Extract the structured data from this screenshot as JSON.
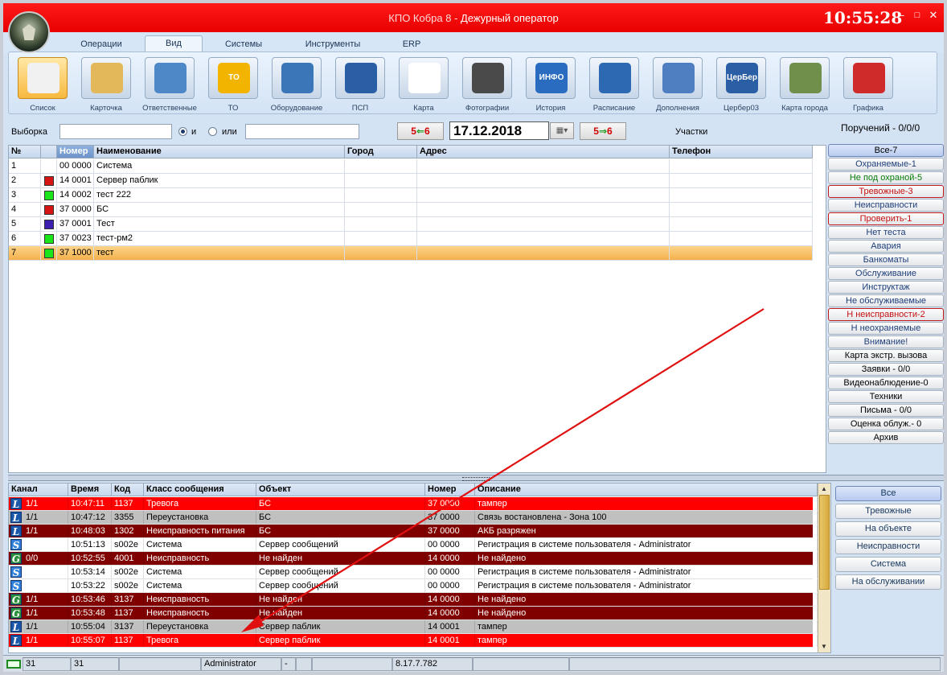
{
  "window": {
    "app_name": "КПО Кобра 8 - ",
    "role": "Дежурный оператор",
    "clock": "10:55:28"
  },
  "tabs": [
    {
      "label": "Операции"
    },
    {
      "label": "Вид"
    },
    {
      "label": "Системы"
    },
    {
      "label": "Инструменты"
    },
    {
      "label": "ERP"
    }
  ],
  "ribbon": [
    {
      "label": "Список",
      "icon": "list-icon",
      "glyph": ""
    },
    {
      "label": "Карточка",
      "icon": "folder-icon",
      "glyph": ""
    },
    {
      "label": "Ответственные",
      "icon": "people-icon",
      "glyph": ""
    },
    {
      "label": "ТО",
      "icon": "maintenance-icon",
      "glyph": "ТО"
    },
    {
      "label": "Оборудование",
      "icon": "equipment-icon",
      "glyph": ""
    },
    {
      "label": "ПСП",
      "icon": "signature-icon",
      "glyph": ""
    },
    {
      "label": "Карта",
      "icon": "floorplan-icon",
      "glyph": ""
    },
    {
      "label": "Фотографии",
      "icon": "camera-icon",
      "glyph": ""
    },
    {
      "label": "История",
      "icon": "history-info-icon",
      "glyph": "ИНФО"
    },
    {
      "label": "Расписание",
      "icon": "calendar-icon",
      "glyph": ""
    },
    {
      "label": "Дополнения",
      "icon": "documents-icon",
      "glyph": ""
    },
    {
      "label": "Цербер03",
      "icon": "cerber-icon",
      "glyph": "ЦерБер"
    },
    {
      "label": "Карта города",
      "icon": "city-map-icon",
      "glyph": ""
    },
    {
      "label": "Графика",
      "icon": "graphics-icon",
      "glyph": ""
    }
  ],
  "filter": {
    "selection_label": "Выборка",
    "and_label": "и",
    "or_label": "или",
    "swap_left": "5",
    "swap_right": "6",
    "date": "17.12.2018",
    "sections_label": "Участки",
    "orders": "Поручений - 0/0/0"
  },
  "objects": {
    "columns": [
      "№",
      "",
      "Номер",
      "Наименование",
      "Город",
      "Адрес",
      "Телефон"
    ],
    "rows": [
      {
        "n": "1",
        "num": "00  0000",
        "name": "Система",
        "color": ""
      },
      {
        "n": "2",
        "num": "14  0001",
        "name": "Сервер паблик",
        "color": "#d61414"
      },
      {
        "n": "3",
        "num": "14  0002",
        "name": "тест 222",
        "color": "#19e619"
      },
      {
        "n": "4",
        "num": "37  0000",
        "name": "БС",
        "color": "#d61414"
      },
      {
        "n": "5",
        "num": "37  0001",
        "name": "Тест",
        "color": "#3c1fb0"
      },
      {
        "n": "6",
        "num": "37  0023",
        "name": "тест-рм2",
        "color": "#19e619"
      },
      {
        "n": "7",
        "num": "37  1000",
        "name": "тест",
        "color": "#19e619"
      }
    ]
  },
  "object_filters": [
    {
      "label": "Все-7",
      "color": "#000000"
    },
    {
      "label": "Охраняемые-1",
      "color": "#1f3f7a"
    },
    {
      "label": "Не под охраной-5",
      "color": "#0a7d0a"
    },
    {
      "label": "Тревожные-3",
      "color": "#c41010"
    },
    {
      "label": "Неисправности",
      "color": "#1f3f7a"
    },
    {
      "label": "Проверить-1",
      "color": "#c41010"
    },
    {
      "label": "Нет теста",
      "color": "#1f3f7a"
    },
    {
      "label": "Авария",
      "color": "#1f3f7a"
    },
    {
      "label": "Банкоматы",
      "color": "#1f3f7a"
    },
    {
      "label": "Обслуживание",
      "color": "#1f3f7a"
    },
    {
      "label": "Инструктаж",
      "color": "#1f3f7a"
    },
    {
      "label": "Не обслуживаемые",
      "color": "#1f3f7a"
    },
    {
      "label": "Н неисправности-2",
      "color": "#c41010"
    },
    {
      "label": "Н неохраняемые",
      "color": "#1f3f7a"
    },
    {
      "label": "Внимание!",
      "color": "#1f3f7a"
    },
    {
      "label": "Карта экстр. вызова",
      "color": "#000000"
    },
    {
      "label": "Заявки - 0/0",
      "color": "#000000"
    },
    {
      "label": "Видеонаблюдение-0",
      "color": "#000000"
    },
    {
      "label": "Техники",
      "color": "#000000"
    },
    {
      "label": "Письма - 0/0",
      "color": "#000000"
    },
    {
      "label": "Оценка облуж.- 0",
      "color": "#000000"
    },
    {
      "label": "Архив",
      "color": "#000000"
    }
  ],
  "events": {
    "columns": [
      "Канал",
      "Время",
      "Код",
      "Класс сообщения",
      "Объект",
      "Номер",
      "Описание"
    ],
    "rows": [
      {
        "icon": "L",
        "ch": "1/1",
        "time": "10:47:11",
        "code": "1137",
        "cls": "Тревога",
        "obj": "БС",
        "num": "37 0000",
        "desc": "тампер",
        "bg": "#ff0000",
        "fg": "#ffffff"
      },
      {
        "icon": "L",
        "ch": "1/1",
        "time": "10:47:12",
        "code": "3355",
        "cls": "Переустановка",
        "obj": "БС",
        "num": "37 0000",
        "desc": "Связь востановлена - Зона 100",
        "bg": "#c0c0c0",
        "fg": "#000000"
      },
      {
        "icon": "L",
        "ch": "1/1",
        "time": "10:48:03",
        "code": "1302",
        "cls": "Неисправность питания",
        "obj": "БС",
        "num": "37 0000",
        "desc": "АКБ разряжен",
        "bg": "#800000",
        "fg": "#ffffff"
      },
      {
        "icon": "S",
        "ch": "",
        "time": "10:51:13",
        "code": "s002e",
        "cls": "Система",
        "obj": "Сервер сообщений",
        "num": "00 0000",
        "desc": "Регистрация в системе пользователя - Administrator",
        "bg": "#ffffff",
        "fg": "#000000"
      },
      {
        "icon": "G",
        "ch": "0/0",
        "time": "10:52:55",
        "code": "4001",
        "cls": "Неисправность",
        "obj": "Не найден",
        "num": "14 0000",
        "desc": "Не найдено",
        "bg": "#800000",
        "fg": "#ffffff"
      },
      {
        "icon": "S",
        "ch": "",
        "time": "10:53:14",
        "code": "s002e",
        "cls": "Система",
        "obj": "Сервер сообщений",
        "num": "00 0000",
        "desc": "Регистрация в системе пользователя - Administrator",
        "bg": "#ffffff",
        "fg": "#000000"
      },
      {
        "icon": "S",
        "ch": "",
        "time": "10:53:22",
        "code": "s002e",
        "cls": "Система",
        "obj": "Сервер сообщений",
        "num": "00 0000",
        "desc": "Регистрация в системе пользователя - Administrator",
        "bg": "#ffffff",
        "fg": "#000000"
      },
      {
        "icon": "G",
        "ch": "1/1",
        "time": "10:53:46",
        "code": "3137",
        "cls": "Неисправность",
        "obj": "Не найден",
        "num": "14 0000",
        "desc": "Не найдено",
        "bg": "#800000",
        "fg": "#ffffff"
      },
      {
        "icon": "G",
        "ch": "1/1",
        "time": "10:53:48",
        "code": "1137",
        "cls": "Неисправность",
        "obj": "Не найден",
        "num": "14 0000",
        "desc": "Не найдено",
        "bg": "#800000",
        "fg": "#ffffff"
      },
      {
        "icon": "L",
        "ch": "1/1",
        "time": "10:55:04",
        "code": "3137",
        "cls": "Переустановка",
        "obj": "Сервер паблик",
        "num": "14 0001",
        "desc": "тампер",
        "bg": "#c0c0c0",
        "fg": "#000000"
      },
      {
        "icon": "L",
        "ch": "1/1",
        "time": "10:55:07",
        "code": "1137",
        "cls": "Тревога",
        "obj": "Сервер паблик",
        "num": "14 0001",
        "desc": "тампер",
        "bg": "#ff0000",
        "fg": "#ffffff"
      }
    ]
  },
  "event_filters": [
    {
      "label": "Все"
    },
    {
      "label": "Тревожные"
    },
    {
      "label": "На объекте"
    },
    {
      "label": "Неисправности"
    },
    {
      "label": "Система"
    },
    {
      "label": "На обслуживании"
    }
  ],
  "status": {
    "count1": "31",
    "count2": "31",
    "user": "Administrator",
    "dash": "-",
    "version": "8.17.7.782"
  },
  "annotation_color": "#e01010"
}
